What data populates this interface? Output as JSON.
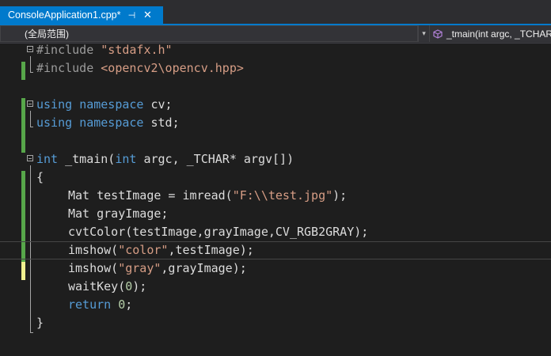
{
  "tab": {
    "title": "ConsoleApplication1.cpp*",
    "pin_glyph": "⊣",
    "close_glyph": "✕"
  },
  "navbar": {
    "scope": "(全局范围)",
    "member": "_tmain(int argc, _TCHAR"
  },
  "colors": {
    "accent": "#007acc",
    "keyword": "#569cd6",
    "string": "#d69d85",
    "saved_change": "#57a64a",
    "unsaved_change": "#efef8f"
  },
  "code": {
    "l1_pp": "#include",
    "l1_str": "\"stdafx.h\"",
    "l2_pp": "#include",
    "l2_str": "<opencv2\\opencv.hpp>",
    "l4_kw1": "using",
    "l4_kw2": "namespace",
    "l4_rest": "cv;",
    "l5_kw1": "using",
    "l5_kw2": "namespace",
    "l5_rest": "std;",
    "l7_kw": "int",
    "l7_rest1": "_tmain(",
    "l7_kw2": "int",
    "l7_rest2": "argc, _TCHAR* argv[])",
    "l8": "{",
    "l9_a": "Mat testImage = imread(",
    "l9_str": "\"F:\\\\test.jpg\"",
    "l9_b": ");",
    "l10": "Mat grayImage;",
    "l11": "cvtColor(testImage,grayImage,CV_RGB2GRAY);",
    "l12_a": "imshow(",
    "l12_str": "\"color\"",
    "l12_b": ",testImage);",
    "l13_a": "imshow(",
    "l13_str": "\"gray\"",
    "l13_b": ",grayImage);",
    "l14_a": "waitKey(",
    "l14_num": "0",
    "l14_b": ");",
    "l15_kw": "return",
    "l15_num": "0",
    "l15_b": ";",
    "l16": "}"
  }
}
